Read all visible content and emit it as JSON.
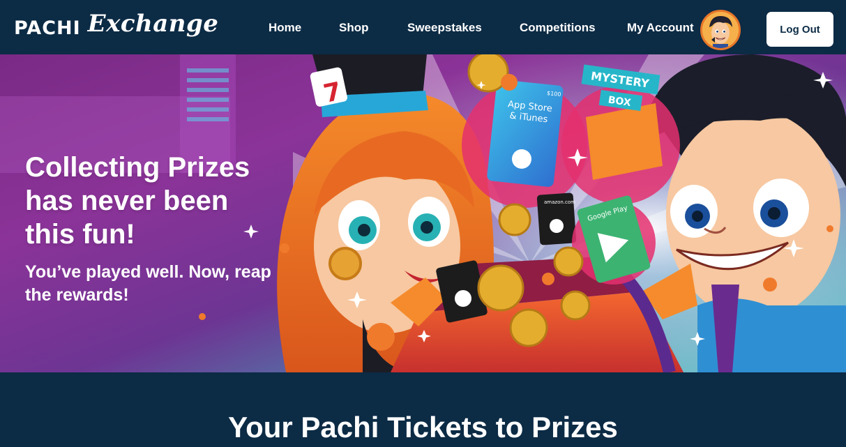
{
  "brand": {
    "name_part1": "PACHI",
    "name_part2": "Exchange"
  },
  "nav": {
    "items": [
      {
        "label": "Home"
      },
      {
        "label": "Shop"
      },
      {
        "label": "Sweepstakes"
      },
      {
        "label": "Competitions"
      },
      {
        "label": "My Account"
      }
    ],
    "logout_label": "Log Out"
  },
  "hero": {
    "title": "Collecting Prizes has never been this fun!",
    "subtitle": "You’ve played well. Now, reap the rewards!",
    "card_itunes_line1": "App Store",
    "card_itunes_line2": "& iTunes",
    "card_itunes_value": "$100",
    "mystery_line1": "MYSTERY",
    "mystery_line2": "BOX",
    "card_amazon_label": "amazon.com",
    "card_google_label": "Google Play"
  },
  "section": {
    "heading": "Your Pachi Tickets to Prizes"
  },
  "colors": {
    "navbar_bg": "#0c2b45",
    "hero_purple": "#8b3398",
    "hero_teal": "#59c6c8",
    "accent_orange": "#f08a2c",
    "button_bg": "#ffffff"
  }
}
